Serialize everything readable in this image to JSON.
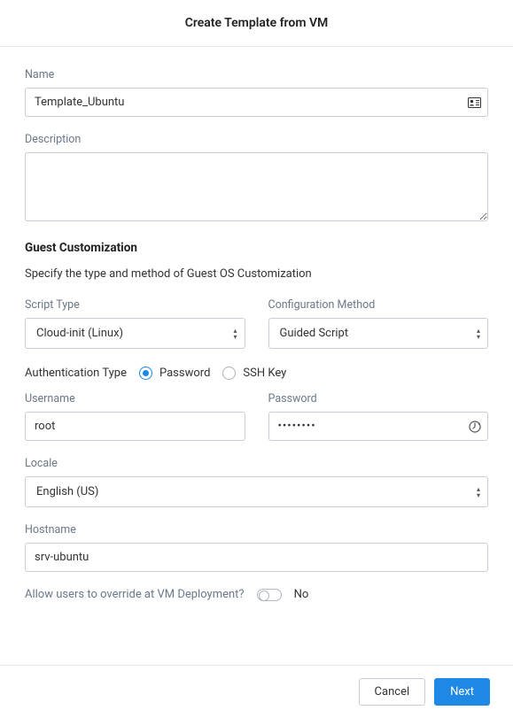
{
  "dialog": {
    "title": "Create Template from VM"
  },
  "fields": {
    "name": {
      "label": "Name",
      "value": "Template_Ubuntu"
    },
    "description": {
      "label": "Description",
      "value": ""
    }
  },
  "guest": {
    "header": "Guest Customization",
    "description": "Specify the type and method of Guest OS Customization",
    "scriptType": {
      "label": "Script Type",
      "value": "Cloud-init (Linux)"
    },
    "configMethod": {
      "label": "Configuration Method",
      "value": "Guided Script"
    },
    "authType": {
      "label": "Authentication Type",
      "options": {
        "password": "Password",
        "sshKey": "SSH Key"
      },
      "selected": "password"
    },
    "username": {
      "label": "Username",
      "value": "root"
    },
    "password": {
      "label": "Password",
      "value": "••••••••"
    },
    "locale": {
      "label": "Locale",
      "value": "English (US)"
    },
    "hostname": {
      "label": "Hostname",
      "value": "srv-ubuntu"
    },
    "override": {
      "label": "Allow users to override at VM Deployment?",
      "value": "No"
    }
  },
  "buttons": {
    "cancel": "Cancel",
    "next": "Next"
  }
}
